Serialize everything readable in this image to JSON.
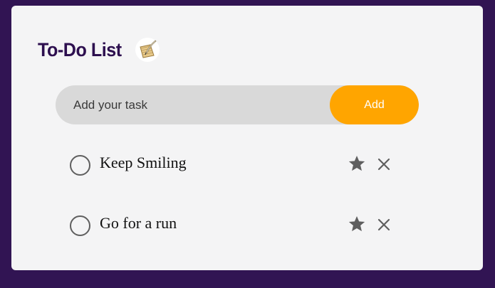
{
  "app": {
    "title": "To-Do List",
    "title_icon": "notepad-quill-icon"
  },
  "input": {
    "placeholder": "Add your task",
    "value": ""
  },
  "add_button": {
    "label": "Add"
  },
  "tasks": [
    {
      "text": "Keep Smiling",
      "completed": false,
      "starred": false,
      "icons": [
        "circle-checkbox-icon",
        "star-icon",
        "close-icon"
      ]
    },
    {
      "text": "Go for a run",
      "completed": false,
      "starred": false,
      "icons": [
        "circle-checkbox-icon",
        "star-icon",
        "close-icon"
      ]
    }
  ],
  "colors": {
    "page_background": "#311453",
    "card_background": "#f4f4f5",
    "title": "#2d0f4f",
    "input_background": "#d9d9d9",
    "accent_button": "#ffa500",
    "icon_gray": "#5f5f5f"
  }
}
